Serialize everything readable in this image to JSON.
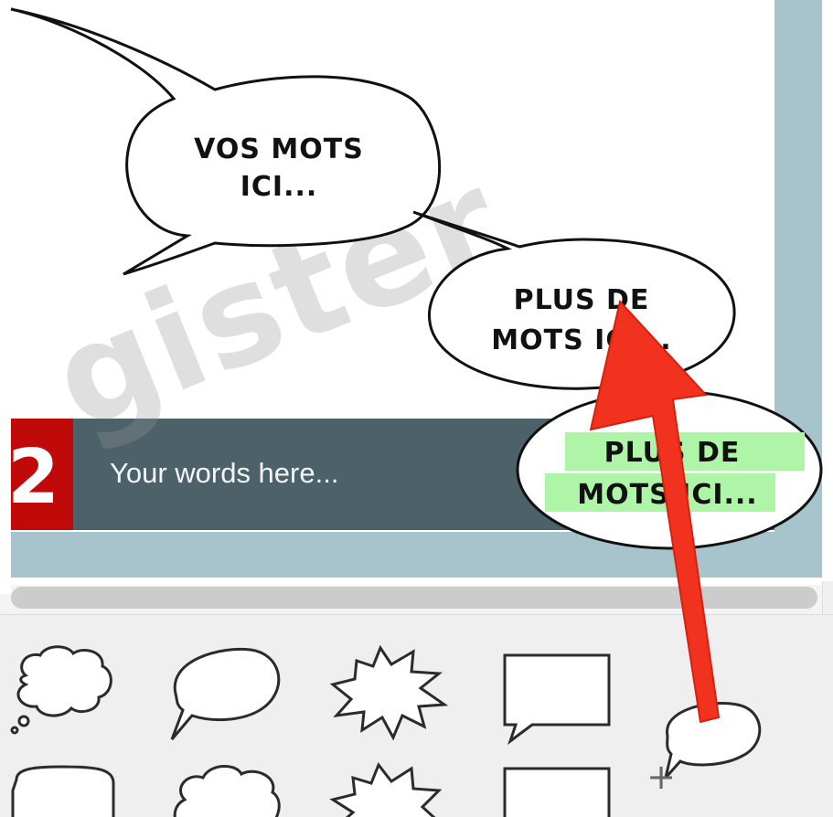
{
  "canvas": {
    "caption_number": "2",
    "caption_text": "Your words here...",
    "watermark_text": "gister",
    "colors": {
      "frame_border": "#a7c4cd",
      "caption_bar": "#4d6268",
      "caption_number_box": "#c00a0a"
    }
  },
  "bubbles": [
    {
      "name": "speech-bubble-french",
      "lines": [
        "VOS MOTS",
        "ICI..."
      ]
    },
    {
      "name": "speech-bubble-more",
      "lines": [
        "PLUS DE",
        "MOTS ICI..."
      ]
    },
    {
      "name": "speech-bubble-dragged",
      "lines": [
        "PLUS DE",
        "MOTS ICI..."
      ],
      "highlight_color": "#aef5a7"
    }
  ],
  "palette": {
    "items": [
      {
        "name": "cloud-thought-bubble-icon"
      },
      {
        "name": "oval-speech-bubble-icon"
      },
      {
        "name": "burst-shout-bubble-icon"
      },
      {
        "name": "rectangle-speech-bubble-icon"
      },
      {
        "name": "rounded-box-bubble-icon"
      },
      {
        "name": "cloud-bubble-icon"
      },
      {
        "name": "burst-bubble-icon"
      },
      {
        "name": "rectangle-box-bubble-icon"
      }
    ],
    "drag_preview": {
      "name": "dragged-oval-bubble-icon"
    },
    "cursor_symbol": "+"
  },
  "annotation": {
    "arrow_color": "#f0321e"
  }
}
